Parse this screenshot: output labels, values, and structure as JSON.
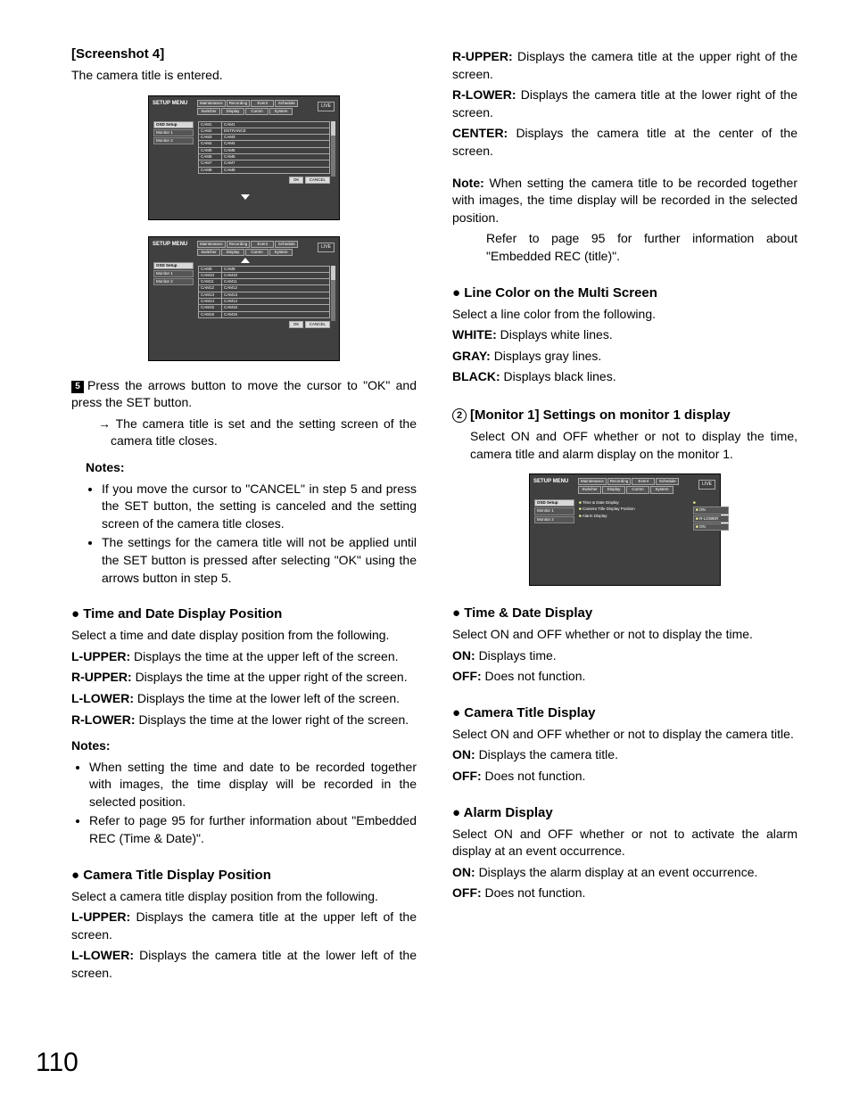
{
  "page_number": "110",
  "left": {
    "shot_heading": "[Screenshot 4]",
    "shot_intro": "The camera title is entered.",
    "step5_text": "Press the arrows button to move the cursor to \"OK\" and press the SET button.",
    "step5_sub": "The camera title is set and the setting screen of the camera title closes.",
    "notes_label": "Notes:",
    "notes": [
      "If you move the cursor to \"CANCEL\" in step 5 and press the SET button, the setting is canceled and the setting screen of the camera title closes.",
      "The settings for the camera title will not be applied until the SET button is pressed after selecting \"OK\" using the arrows button in step 5."
    ],
    "td_pos_h": "Time and Date Display Position",
    "td_pos_intro": "Select a time and date display position from the following.",
    "td_pos": [
      {
        "k": "L-UPPER:",
        "v": "Displays the time at the upper left of the screen."
      },
      {
        "k": "R-UPPER:",
        "v": "Displays the time at the upper right of the screen."
      },
      {
        "k": "L-LOWER:",
        "v": "Displays the time at the lower left of the screen."
      },
      {
        "k": "R-LOWER:",
        "v": "Displays the time at the lower right of the screen."
      }
    ],
    "td_notes_label": "Notes:",
    "td_notes": [
      "When setting the time and date to be recorded together with images, the time display will be recorded in the selected position.",
      "Refer to page 95 for further information about \"Embedded REC (Time & Date)\"."
    ],
    "ct_pos_h": "Camera Title Display Position",
    "ct_pos_intro": "Select a camera title display position from the following.",
    "ct_pos_a": [
      {
        "k": "L-UPPER:",
        "v": "Displays the camera title at the upper left of the screen."
      },
      {
        "k": "L-LOWER:",
        "v": "Displays the camera title at the lower left of the screen."
      }
    ]
  },
  "right": {
    "ct_pos_b": [
      {
        "k": "R-UPPER:",
        "v": "Displays the camera title at the upper right of the screen."
      },
      {
        "k": "R-LOWER:",
        "v": "Displays the camera title at the lower right of the screen."
      },
      {
        "k": "CENTER:",
        "v": "Displays the camera title at the center of the screen."
      }
    ],
    "note_label": "Note:",
    "note_body": "When setting the camera title to be recorded together with images, the time display will be recorded in the selected position.",
    "note_body2": "Refer to page 95 for further information about \"Embedded REC (title)\".",
    "line_h": "Line Color on the Multi Screen",
    "line_intro": "Select a line color from the following.",
    "line": [
      {
        "k": "WHITE:",
        "v": "Displays white lines."
      },
      {
        "k": "GRAY:",
        "v": "Displays gray lines."
      },
      {
        "k": "BLACK:",
        "v": "Displays black lines."
      }
    ],
    "mon_num": "2",
    "mon_h": "[Monitor 1] Settings on monitor 1 display",
    "mon_body": "Select ON and OFF whether or not to display the time, camera title and alarm display on the monitor 1.",
    "tdd_h": "Time & Date Display",
    "tdd_intro": "Select ON and OFF whether or not to display the time.",
    "tdd": [
      {
        "k": "ON:",
        "v": "Displays time."
      },
      {
        "k": "OFF:",
        "v": "Does not function."
      }
    ],
    "ctd_h": "Camera Title Display",
    "ctd_intro": "Select ON and OFF whether or not to display the camera title.",
    "ctd": [
      {
        "k": "ON:",
        "v": "Displays the camera title."
      },
      {
        "k": "OFF:",
        "v": "Does not function."
      }
    ],
    "ad_h": "Alarm Display",
    "ad_intro": "Select ON and OFF whether or not to activate the alarm display at an event occurrence.",
    "ad": [
      {
        "k": "ON:",
        "v": "Displays the alarm display at an event occurrence."
      },
      {
        "k": "OFF:",
        "v": "Does not function."
      }
    ]
  },
  "mock": {
    "title": "SETUP MENU",
    "live": "LIVE",
    "tabs1": [
      "Maintenance",
      "Recording",
      "Event",
      "Schedule"
    ],
    "tabs2": [
      "Switcher",
      "Display",
      "Comm",
      "System"
    ],
    "side_hd": "OSD Setup",
    "side1": "Monitor 1",
    "side2": "Monitor 2",
    "ok": "OK",
    "cancel": "CANCEL",
    "rows1": [
      [
        "CAM1",
        "CAM1"
      ],
      [
        "CAM2",
        "ENTRANCE"
      ],
      [
        "CAM3",
        "CAM3"
      ],
      [
        "CAM4",
        "CAM4"
      ],
      [
        "CAM5",
        "CAM5"
      ],
      [
        "CAM6",
        "CAM6"
      ],
      [
        "CAM7",
        "CAM7"
      ],
      [
        "CAM8",
        "CAM8"
      ]
    ],
    "rows2": [
      [
        "CAM9",
        "CAM9"
      ],
      [
        "CAM10",
        "CAM10"
      ],
      [
        "CAM11",
        "CAM11"
      ],
      [
        "CAM12",
        "CAM12"
      ],
      [
        "CAM13",
        "CAM13"
      ],
      [
        "CAM14",
        "CAM14"
      ],
      [
        "CAM15",
        "CAM15"
      ],
      [
        "CAM16",
        "CAM16"
      ]
    ],
    "list3": [
      "Time & Date Display",
      "Camera Title Display Position",
      "Alarm Display"
    ],
    "vals3": [
      "ON",
      "R-LOWER",
      "ON"
    ]
  }
}
